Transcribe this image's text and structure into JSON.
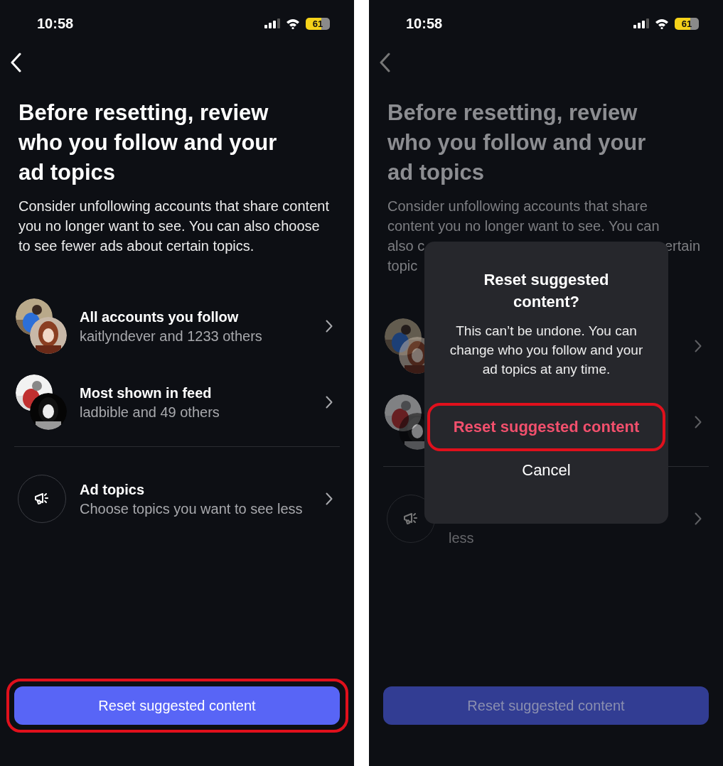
{
  "screens": [
    {
      "dimmed": false,
      "status_bar": {
        "time": "10:58",
        "battery": "61"
      },
      "title": "Before resetting, review who you follow and your ad topics",
      "description_lines": [
        {
          "parts": [
            "Consider unfollowing accounts that share content you no longer want to see. You can also choose to see fewer ads about certain topics."
          ]
        }
      ],
      "rows": [
        {
          "kind": "avatars",
          "title": "All accounts you follow",
          "subtitle": "kaitlyndever and 1233 others"
        },
        {
          "kind": "avatars",
          "title": "Most shown in feed",
          "subtitle": "ladbible and 49 others"
        },
        {
          "kind": "icon",
          "title": "Ad topics",
          "subtitle": "Choose topics you want to see less"
        }
      ],
      "button": {
        "label": "Reset suggested content",
        "highlighted": true
      }
    },
    {
      "dimmed": true,
      "status_bar": {
        "time": "10:58",
        "battery": "61"
      },
      "title": "Before resetting, review who you follow and your ad topics",
      "description_lines": [
        {
          "parts": [
            "Consider unfollowing accounts that share"
          ]
        },
        {
          "parts": [
            "content you no longer want to see. You can"
          ]
        },
        {
          "parts": [
            "also c",
            "ertain"
          ]
        },
        {
          "parts": [
            "topic"
          ]
        }
      ],
      "rows": [
        {
          "kind": "avatars"
        },
        {
          "kind": "avatars"
        },
        {
          "kind": "icon",
          "subtitle_tail": "less"
        }
      ],
      "button": {
        "label": "Reset suggested content",
        "highlighted": false
      },
      "dialog": {
        "title": "Reset suggested content?",
        "message": "This can’t be undone. You can change who you follow and your ad topics at any time.",
        "confirm": {
          "label": "Reset suggested content",
          "highlighted": true
        },
        "cancel": "Cancel"
      }
    }
  ]
}
